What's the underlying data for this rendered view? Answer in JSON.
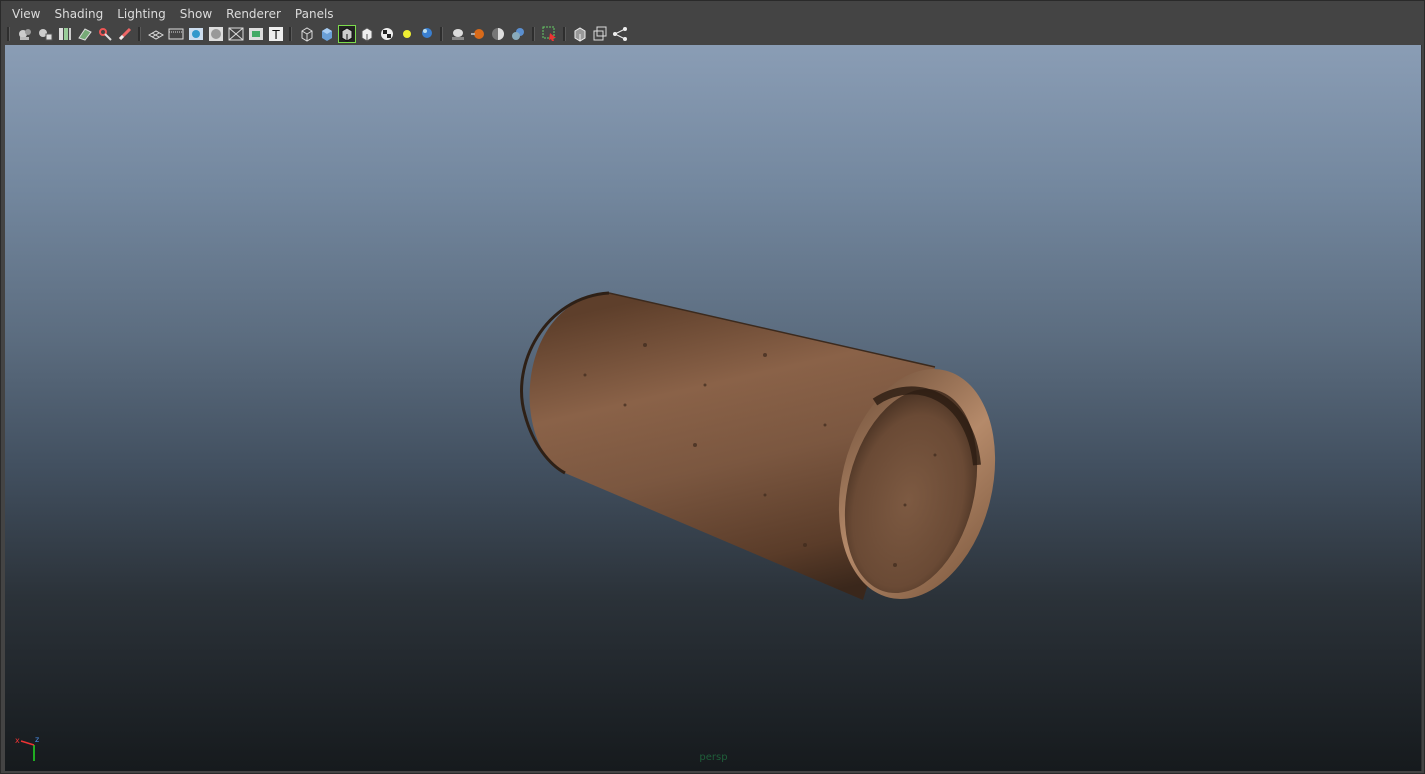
{
  "menu": [
    "View",
    "Shading",
    "Lighting",
    "Show",
    "Renderer",
    "Panels"
  ],
  "toolbar": {
    "icons": [
      "select-camera-icon",
      "lock-camera-icon",
      "bookmarks-icon",
      "image-plane-icon",
      "2d-pan-zoom-icon",
      "grease-pencil-icon",
      "grid-icon",
      "film-gate-icon",
      "resolution-gate-icon",
      "gate-mask-icon",
      "field-chart-icon",
      "safe-action-icon",
      "safe-title-icon",
      "wireframe-icon",
      "smooth-shade-icon",
      "wireframe-on-shaded-icon",
      "default-material-icon",
      "textured-icon",
      "use-all-lights-icon",
      "shadows-icon",
      "screen-space-ao-icon",
      "motion-blur-icon",
      "anti-aliasing-icon",
      "depth-of-field-icon",
      "isolate-select-icon",
      "xray-icon",
      "xray-active-components-icon",
      "xray-joints-icon"
    ],
    "active": "wireframe-on-shaded-icon"
  },
  "viewport": {
    "camera_label": "persp",
    "axis": {
      "x_label": "x",
      "z_label": "z"
    },
    "background_top": "#8a9db5",
    "background_bottom": "#161a1d",
    "object_color": "#7a563c"
  }
}
